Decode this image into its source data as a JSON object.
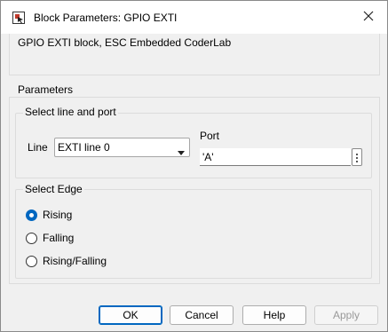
{
  "window": {
    "title": "Block Parameters: GPIO EXTI",
    "icons": {
      "app": "block-parameters-icon",
      "close": "close-icon"
    }
  },
  "description": "GPIO EXTI block, ESC Embedded CoderLab",
  "parameters": {
    "label": "Parameters",
    "line_port_group": {
      "title": "Select line and port",
      "line_label": "Line",
      "line_value": "EXTI line 0",
      "port_label": "Port",
      "port_value": "'A'"
    },
    "edge_group": {
      "title": "Select Edge",
      "options": [
        {
          "label": "Rising",
          "checked": true
        },
        {
          "label": "Falling",
          "checked": false
        },
        {
          "label": "Rising/Falling",
          "checked": false
        }
      ]
    }
  },
  "buttons": {
    "ok": "OK",
    "cancel": "Cancel",
    "help": "Help",
    "apply": "Apply"
  },
  "colors": {
    "accent": "#0067c0"
  }
}
